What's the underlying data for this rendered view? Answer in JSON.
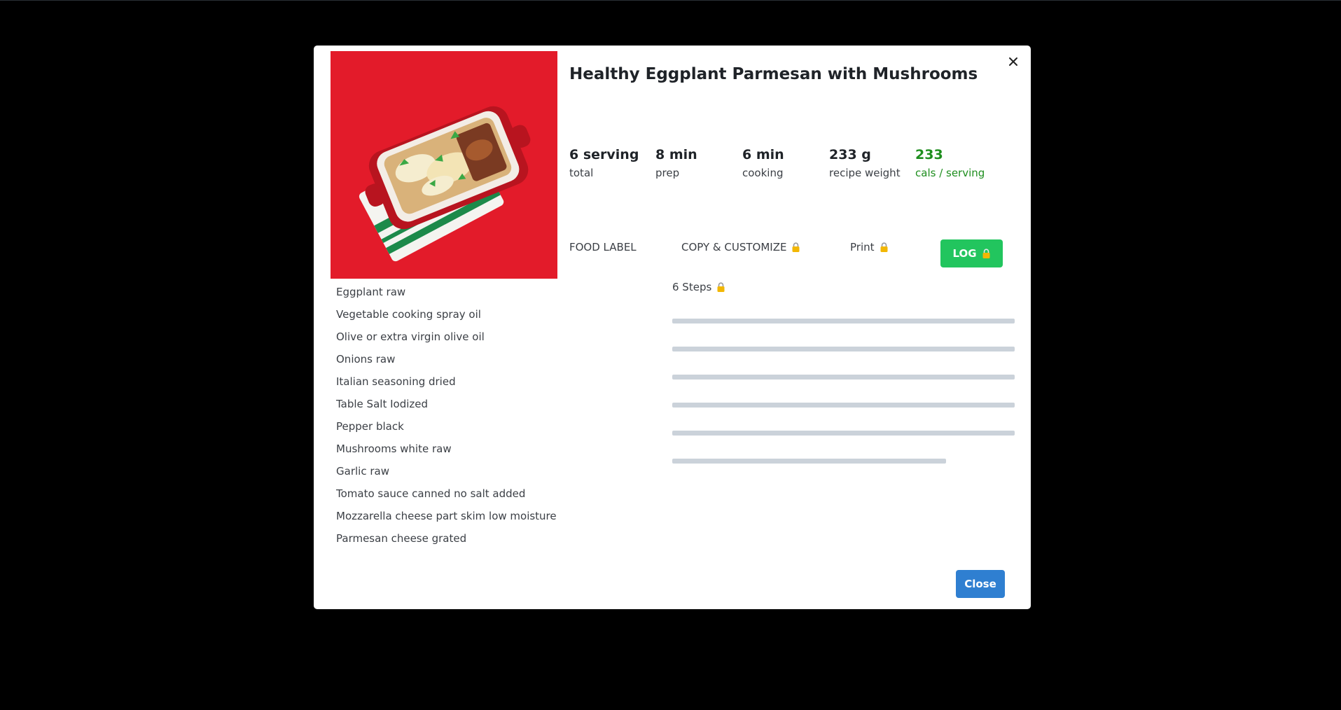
{
  "recipe": {
    "title": "Healthy Eggplant Parmesan with Mushrooms",
    "image_icon": "eggplant-parmesan-photo"
  },
  "stats": [
    {
      "value": "6 serving",
      "label": "total"
    },
    {
      "value": "8 min",
      "label": "prep"
    },
    {
      "value": "6 min",
      "label": "cooking"
    },
    {
      "value": "233 g",
      "label": "recipe weight"
    },
    {
      "value": "233",
      "label": "cals / serving"
    }
  ],
  "actions": {
    "food_label": "FOOD LABEL",
    "copy_customize": "COPY & CUSTOMIZE",
    "print": "Print",
    "log": "LOG"
  },
  "ingredients": [
    "Eggplant raw",
    "Vegetable cooking spray oil",
    "Olive or extra virgin olive oil",
    "Onions raw",
    "Italian seasoning dried",
    "Table Salt Iodized",
    "Pepper black",
    "Mushrooms white raw",
    "Garlic raw",
    "Tomato sauce canned no salt added",
    "Mozzarella cheese part skim low moisture",
    "Parmesan cheese grated"
  ],
  "steps": {
    "header": "6 Steps",
    "placeholder_count": 6
  },
  "footer": {
    "close_label": "Close"
  },
  "colors": {
    "accent_green": "#1e8e1e",
    "log_button": "#22c55e",
    "close_button": "#2f7fd1",
    "image_background": "#e31b2a",
    "placeholder_bar": "#cbd2da"
  }
}
